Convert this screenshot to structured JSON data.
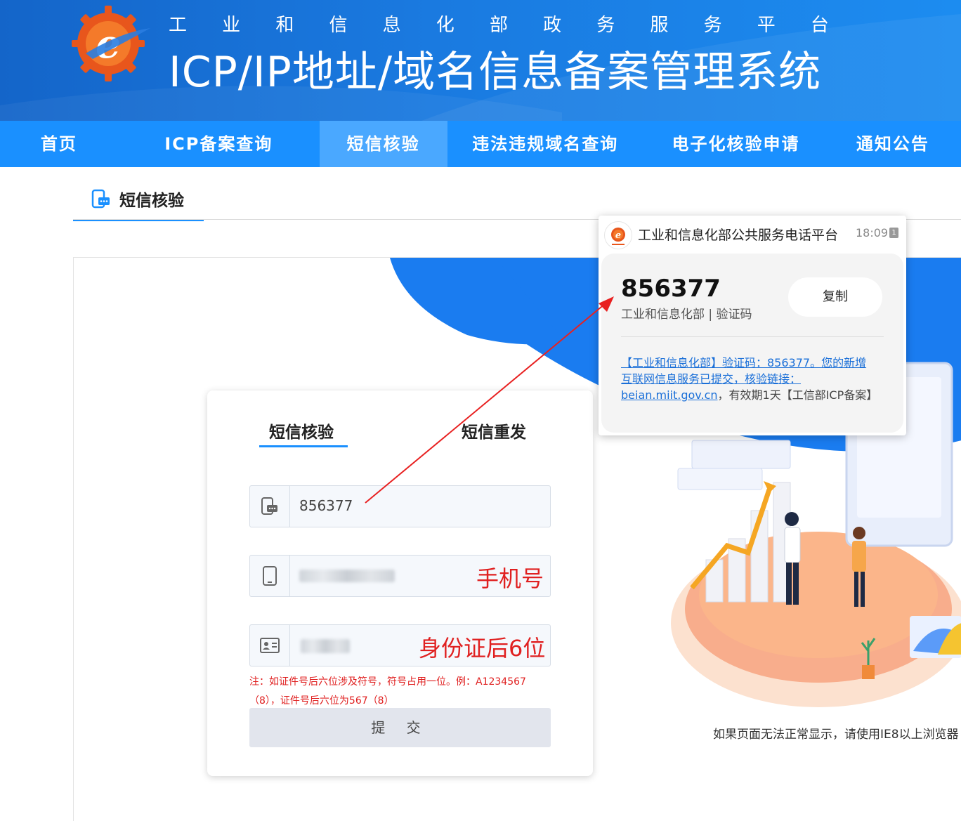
{
  "header": {
    "gov_chars": [
      "工",
      "业",
      "和",
      "信",
      "息",
      "化",
      "部",
      "政",
      "务",
      "服",
      "务",
      "平",
      "台"
    ],
    "system_title": "ICP/IP地址/域名信息备案管理系统"
  },
  "nav": {
    "items": [
      {
        "label": "首页"
      },
      {
        "label": "ICP备案查询"
      },
      {
        "label": "短信核验"
      },
      {
        "label": "违法违规域名查询"
      },
      {
        "label": "电子化核验申请"
      },
      {
        "label": "通知公告"
      }
    ],
    "active_index": 2
  },
  "section": {
    "title": "短信核验"
  },
  "form": {
    "tabs": [
      "短信核验",
      "短信重发"
    ],
    "active_tab": 0,
    "code_value": "856377",
    "phone_annotation": "手机号",
    "id_annotation": "身份证后6位",
    "hint": "注：如证件号后六位涉及符号，符号占用一位。例：A1234567（8），证件号后六位为567（8）",
    "submit_label": "提 交"
  },
  "browser_note": "如果页面无法正常显示，请使用IE8以上浏览器",
  "sms": {
    "sender": "工业和信息化部公共服务电话平台",
    "time": "18:09",
    "sim_label": "1",
    "code": "856377",
    "code_label": "工业和信息化部 | 验证码",
    "copy_label": "复制",
    "message_link": "【工业和信息化部】验证码：856377。您的新增互联网信息服务已提交，核验链接：",
    "message_url": "beian.miit.gov.cn",
    "message_rest": "，有效期1天【工信部ICP备案】"
  },
  "colors": {
    "primary_blue": "#1a90ff",
    "banner_blue": "#1465c9",
    "active_nav": "#4aa8ff",
    "annotation_red": "#e02020",
    "logo_orange": "#e8561c"
  }
}
